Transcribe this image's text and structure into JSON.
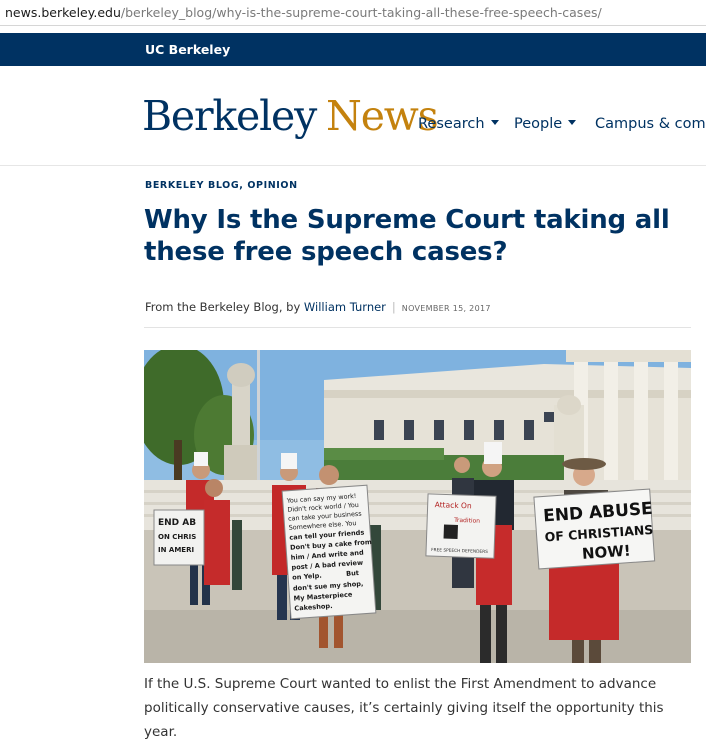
{
  "browser": {
    "url_host": "news.berkeley.edu",
    "url_path": "/berkeley_blog/why-is-the-supreme-court-taking-all-these-free-speech-cases/"
  },
  "topbar": {
    "brand": "UC Berkeley"
  },
  "header": {
    "logo_primary": "Berkeley",
    "logo_secondary": "News",
    "nav": [
      {
        "label": "Research",
        "has_dropdown": true
      },
      {
        "label": "People",
        "has_dropdown": true
      },
      {
        "label": "Campus & comm",
        "has_dropdown": false
      }
    ]
  },
  "article": {
    "kicker": "BERKELEY BLOG, OPINION",
    "title": "Why Is the Supreme Court taking all these free speech cases?",
    "byline_prefix": "From the Berkeley Blog, by ",
    "author": "William Turner",
    "date": "NOVEMBER 15, 2017",
    "body": "If the U.S. Supreme Court wanted to enlist the First Amendment to advance politically conservative causes, it’s certainly giving itself the opportunity this year."
  },
  "photo": {
    "signs": {
      "left": [
        "END AB",
        "ON CHRIS",
        "IN AMERI"
      ],
      "center": [
        "You can say my work!",
        "Didn't rock world / You",
        "can take your business",
        "Somewhere else. You",
        "can tell your friends",
        "Don't buy a cake from",
        "him / And write and",
        "post / A bad review",
        "on Yelp.",
        "But",
        "don't sue my shop,",
        "My Masterpiece",
        "Cakeshop."
      ],
      "small": [
        "Attack On",
        "Tradition",
        "FREE SPEECH DEFENDERS"
      ],
      "right": [
        "END ABUSE",
        "OF CHRISTIANS",
        "NOW!"
      ]
    }
  },
  "colors": {
    "berkeley_blue": "#003262",
    "california_gold": "#c4820e"
  }
}
